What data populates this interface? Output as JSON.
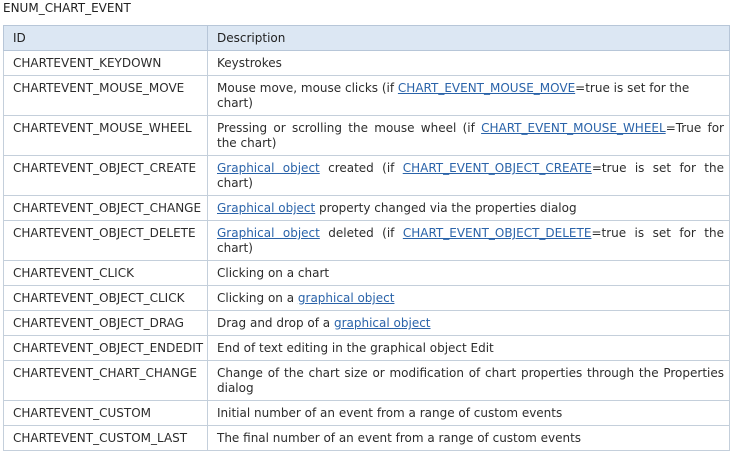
{
  "title": "ENUM_CHART_EVENT",
  "columns": {
    "id": "ID",
    "description": "Description"
  },
  "rows": [
    {
      "id": "CHARTEVENT_KEYDOWN",
      "parts": [
        {
          "t": "Keystrokes"
        }
      ]
    },
    {
      "id": "CHARTEVENT_MOUSE_MOVE",
      "parts": [
        {
          "t": "Mouse move, mouse clicks (if "
        },
        {
          "t": "CHART_EVENT_MOUSE_MOVE",
          "link": true
        },
        {
          "t": "=true is set for the chart)"
        }
      ]
    },
    {
      "id": "CHARTEVENT_MOUSE_WHEEL",
      "justify": true,
      "parts": [
        {
          "t": "Pressing or scrolling the mouse wheel (if "
        },
        {
          "t": "CHART_EVENT_MOUSE_WHEEL",
          "link": true
        },
        {
          "t": "=True for the chart)"
        }
      ]
    },
    {
      "id": "CHARTEVENT_OBJECT_CREATE",
      "justify": true,
      "parts": [
        {
          "t": "Graphical object",
          "link": true
        },
        {
          "t": " created (if "
        },
        {
          "t": "CHART_EVENT_OBJECT_CREATE",
          "link": true
        },
        {
          "t": "=true is set for the chart)"
        }
      ]
    },
    {
      "id": "CHARTEVENT_OBJECT_CHANGE",
      "parts": [
        {
          "t": "Graphical object",
          "link": true
        },
        {
          "t": " property changed via the properties dialog"
        }
      ]
    },
    {
      "id": "CHARTEVENT_OBJECT_DELETE",
      "justify": true,
      "parts": [
        {
          "t": "Graphical object",
          "link": true
        },
        {
          "t": " deleted (if "
        },
        {
          "t": "CHART_EVENT_OBJECT_DELETE",
          "link": true
        },
        {
          "t": "=true is set for the chart)"
        }
      ]
    },
    {
      "id": "CHARTEVENT_CLICK",
      "parts": [
        {
          "t": "Clicking on a chart"
        }
      ]
    },
    {
      "id": "CHARTEVENT_OBJECT_CLICK",
      "parts": [
        {
          "t": "Clicking on a "
        },
        {
          "t": "graphical object",
          "link": true
        }
      ]
    },
    {
      "id": "CHARTEVENT_OBJECT_DRAG",
      "parts": [
        {
          "t": "Drag and drop of a "
        },
        {
          "t": "graphical object",
          "link": true
        }
      ]
    },
    {
      "id": "CHARTEVENT_OBJECT_ENDEDIT",
      "parts": [
        {
          "t": "End of text editing in the graphical object Edit"
        }
      ]
    },
    {
      "id": "CHARTEVENT_CHART_CHANGE",
      "justify": true,
      "parts": [
        {
          "t": "Change of the chart size or modification of chart properties through the Properties dialog"
        }
      ]
    },
    {
      "id": "CHARTEVENT_CUSTOM",
      "parts": [
        {
          "t": "Initial number of an event from a range of custom events"
        }
      ]
    },
    {
      "id": "CHARTEVENT_CUSTOM_LAST",
      "parts": [
        {
          "t": "The final number of an event from a range of custom events"
        }
      ]
    }
  ]
}
